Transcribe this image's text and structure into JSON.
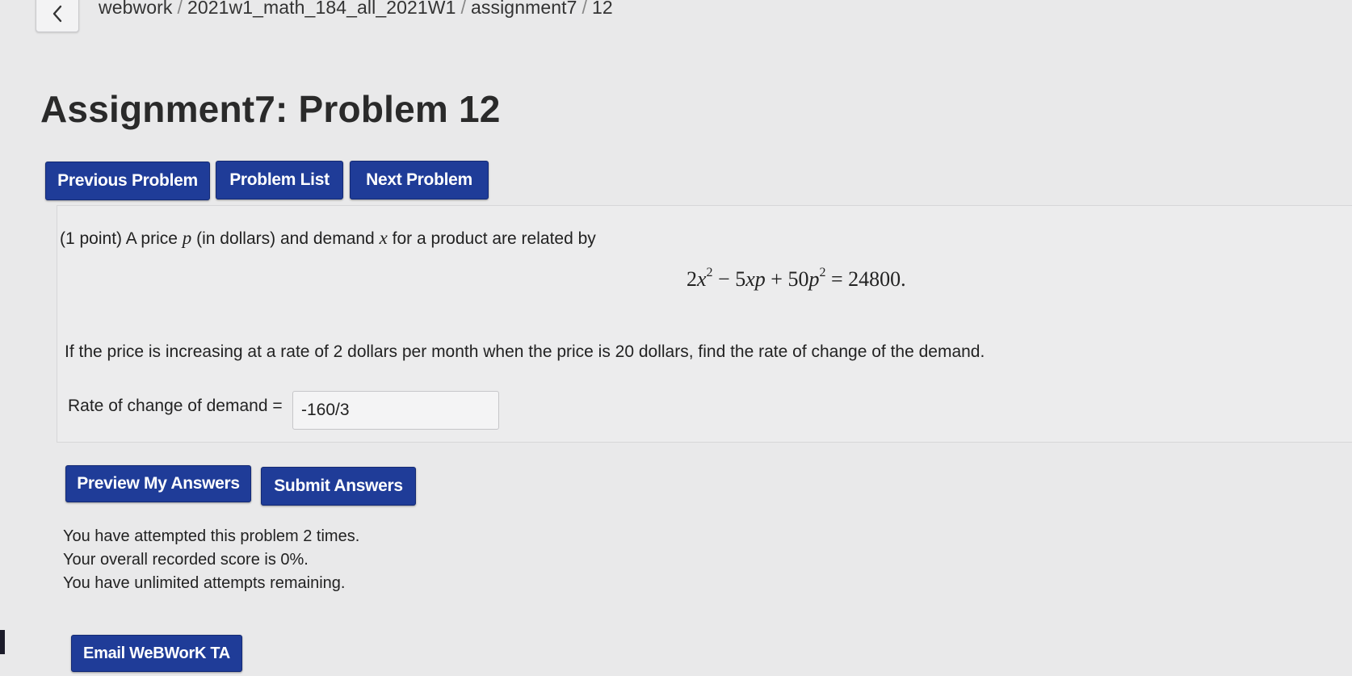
{
  "breadcrumb": {
    "items": [
      "webwork",
      "2021w1_math_184_all_2021W1",
      "assignment7",
      "12"
    ],
    "separator": "/"
  },
  "page": {
    "title": "Assignment7: Problem 12"
  },
  "nav_buttons": {
    "previous": "Previous Problem",
    "list": "Problem List",
    "next": "Next Problem"
  },
  "problem": {
    "intro_points": "(1 point) A price",
    "var_p": "p",
    "intro_mid": "(in dollars) and demand",
    "var_x": "x",
    "intro_end": "for a product are related by",
    "equation": {
      "c1": "2",
      "v1": "x",
      "e1": "2",
      "op1": "−",
      "c2": "5",
      "v2": "xp",
      "op2": "+",
      "c3": "50",
      "v3": "p",
      "e3": "2",
      "eq": "=",
      "rhs": "24800."
    },
    "question": "If the price is increasing at a rate of 2 dollars per month when the price is 20 dollars, find the rate of change of the demand.",
    "answer_label": "Rate of change of demand =",
    "answer_value": "-160/3"
  },
  "actions": {
    "preview": "Preview My Answers",
    "submit": "Submit Answers",
    "email": "Email WeBWorK TA"
  },
  "status": {
    "attempts": "You have attempted this problem 2 times.",
    "score": "Your overall recorded score is 0%.",
    "remaining": "You have unlimited attempts remaining."
  },
  "colors": {
    "button_bg": "#1f3c98",
    "page_bg": "#e9e9ea"
  }
}
